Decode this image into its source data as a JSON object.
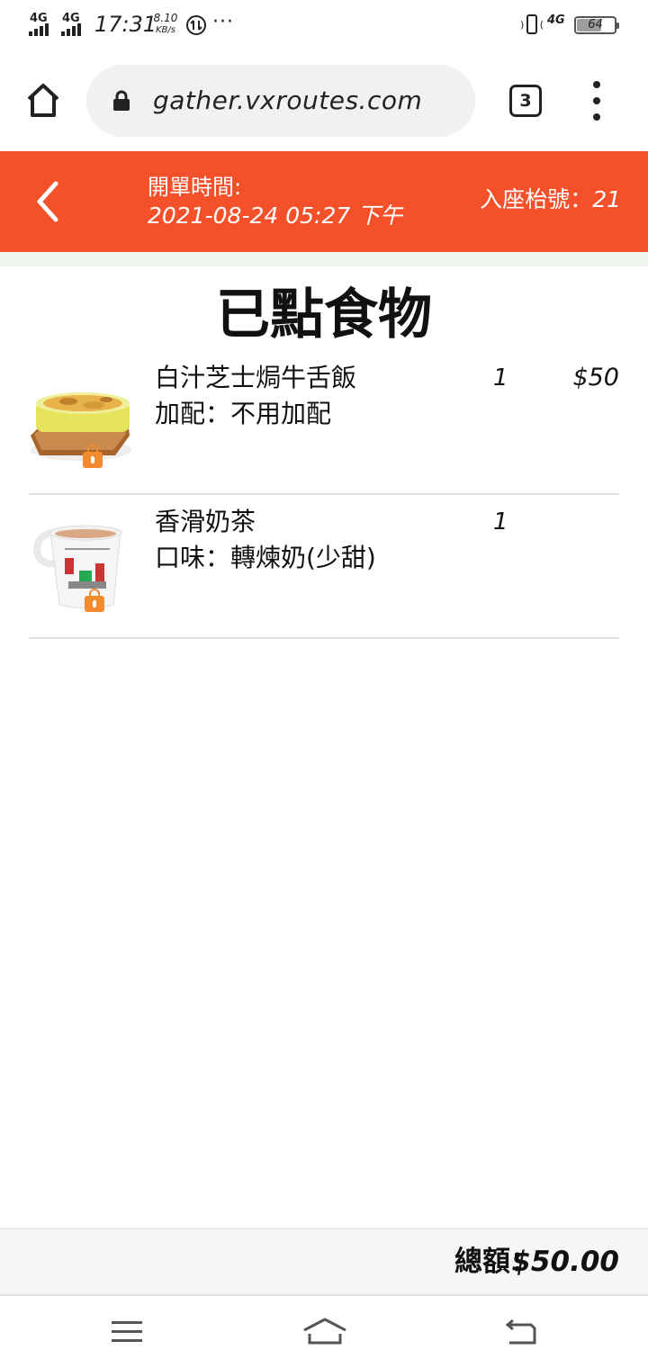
{
  "status_bar": {
    "signal1": "4G",
    "signal2": "4G",
    "time": "17:31",
    "speed_value": "8.10",
    "speed_unit": "KB/s",
    "more": "···",
    "signal3": "4G",
    "battery_level": "64"
  },
  "browser": {
    "url": "gather.vxroutes.com",
    "tab_count": "3"
  },
  "header": {
    "open_label": "開單時間:",
    "open_time": "2021-08-24 05:27 下午",
    "seat_label": "入座枱號：",
    "seat_number": "21",
    "accent_color": "#f4512b"
  },
  "page": {
    "title": "已點食物"
  },
  "items": [
    {
      "name": "白汁芝士焗牛舌飯",
      "option": "加配：不用加配",
      "qty": "1",
      "price": "$50",
      "image": "baked-rice-icon"
    },
    {
      "name": "香滑奶茶",
      "option": "口味：轉煉奶(少甜)",
      "qty": "1",
      "price": "",
      "image": "milk-tea-icon"
    }
  ],
  "footer": {
    "total_label": "總額：",
    "total_value": "$50.00"
  }
}
